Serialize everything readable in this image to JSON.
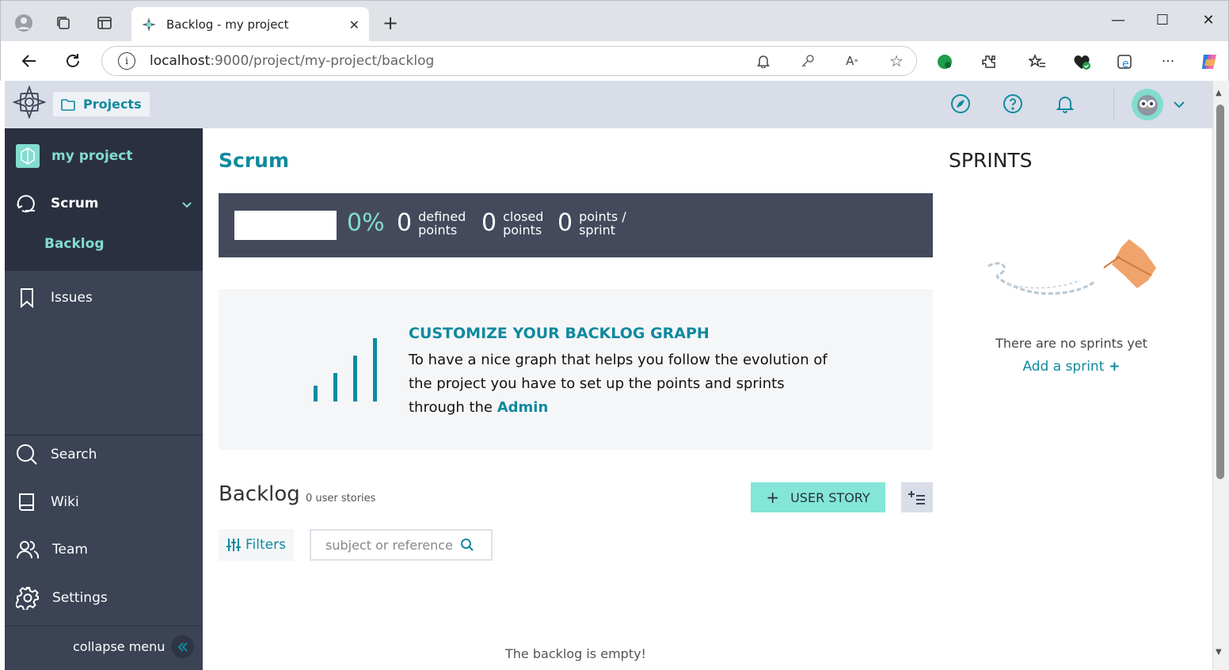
{
  "browser": {
    "tab_title": "Backlog - my project",
    "url_host": "localhost",
    "url_path": ":9000/project/my-project/backlog"
  },
  "topnav": {
    "projects_label": "Projects"
  },
  "sidebar": {
    "project_name": "my project",
    "scrum_label": "Scrum",
    "backlog_label": "Backlog",
    "issues_label": "Issues",
    "search_label": "Search",
    "wiki_label": "Wiki",
    "team_label": "Team",
    "settings_label": "Settings",
    "collapse_label": "collapse menu"
  },
  "main": {
    "title": "Scrum",
    "stats": {
      "percent": "0%",
      "defined_num": "0",
      "defined_l1": "defined",
      "defined_l2": "points",
      "closed_num": "0",
      "closed_l1": "closed",
      "closed_l2": "points",
      "sprint_num": "0",
      "sprint_l1": "points /",
      "sprint_l2": "sprint"
    },
    "graph": {
      "heading": "CUSTOMIZE YOUR BACKLOG GRAPH",
      "text": "To have a nice graph that helps you follow the evolution of the project you have to set up the points and sprints through the ",
      "link": "Admin"
    },
    "backlog": {
      "title": "Backlog",
      "count": "0 user stories",
      "add_label": "USER STORY",
      "filters_label": "Filters",
      "search_placeholder": "subject or reference",
      "empty": "The backlog is empty!"
    }
  },
  "sprints": {
    "title": "SPRINTS",
    "none": "There are no sprints yet",
    "add": "Add a sprint"
  },
  "colors": {
    "accent": "#0f8a9e",
    "mint": "#83dccf",
    "sidebar": "#3b4354",
    "sidebar_dark": "#2a3040"
  }
}
